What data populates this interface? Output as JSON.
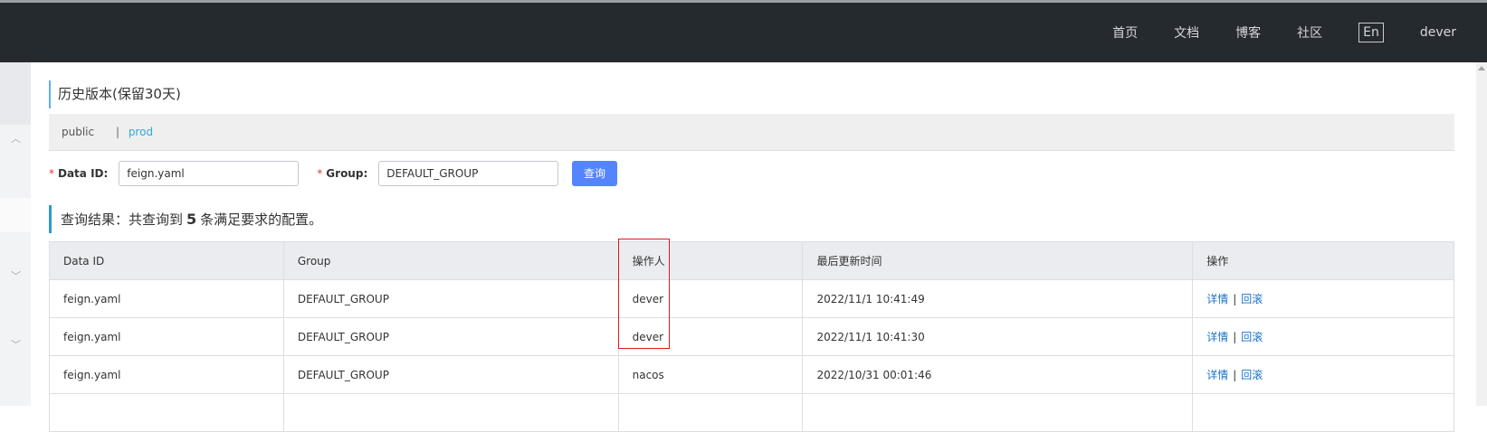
{
  "nav": {
    "items": [
      "首页",
      "文档",
      "博客",
      "社区"
    ],
    "lang": "En",
    "user": "dever"
  },
  "page": {
    "title": "历史版本(保留30天)"
  },
  "namespaces": {
    "first": "public",
    "separator": "|",
    "second": "prod"
  },
  "form": {
    "data_id_label": "Data ID:",
    "data_id_value": "feign.yaml",
    "group_label": "Group:",
    "group_value": "DEFAULT_GROUP",
    "query_button": "查询"
  },
  "result": {
    "prefix": "查询结果：共查询到",
    "count": "5",
    "suffix": "条满足要求的配置。"
  },
  "table": {
    "headers": [
      "Data ID",
      "Group",
      "操作人",
      "最后更新时间",
      "操作"
    ],
    "rows": [
      {
        "data_id": "feign.yaml",
        "group": "DEFAULT_GROUP",
        "operator": "dever",
        "time": "2022/11/1 10:41:49",
        "detail": "详情",
        "rollback": "回滚"
      },
      {
        "data_id": "feign.yaml",
        "group": "DEFAULT_GROUP",
        "operator": "dever",
        "time": "2022/11/1 10:41:30",
        "detail": "详情",
        "rollback": "回滚"
      },
      {
        "data_id": "feign.yaml",
        "group": "DEFAULT_GROUP",
        "operator": "nacos",
        "time": "2022/10/31 00:01:46",
        "detail": "详情",
        "rollback": "回滚"
      }
    ]
  },
  "colors": {
    "topbar": "#252a2f",
    "primary_button": "#5584ff",
    "link": "#1a73c9",
    "highlight_box": "#e0171f"
  }
}
